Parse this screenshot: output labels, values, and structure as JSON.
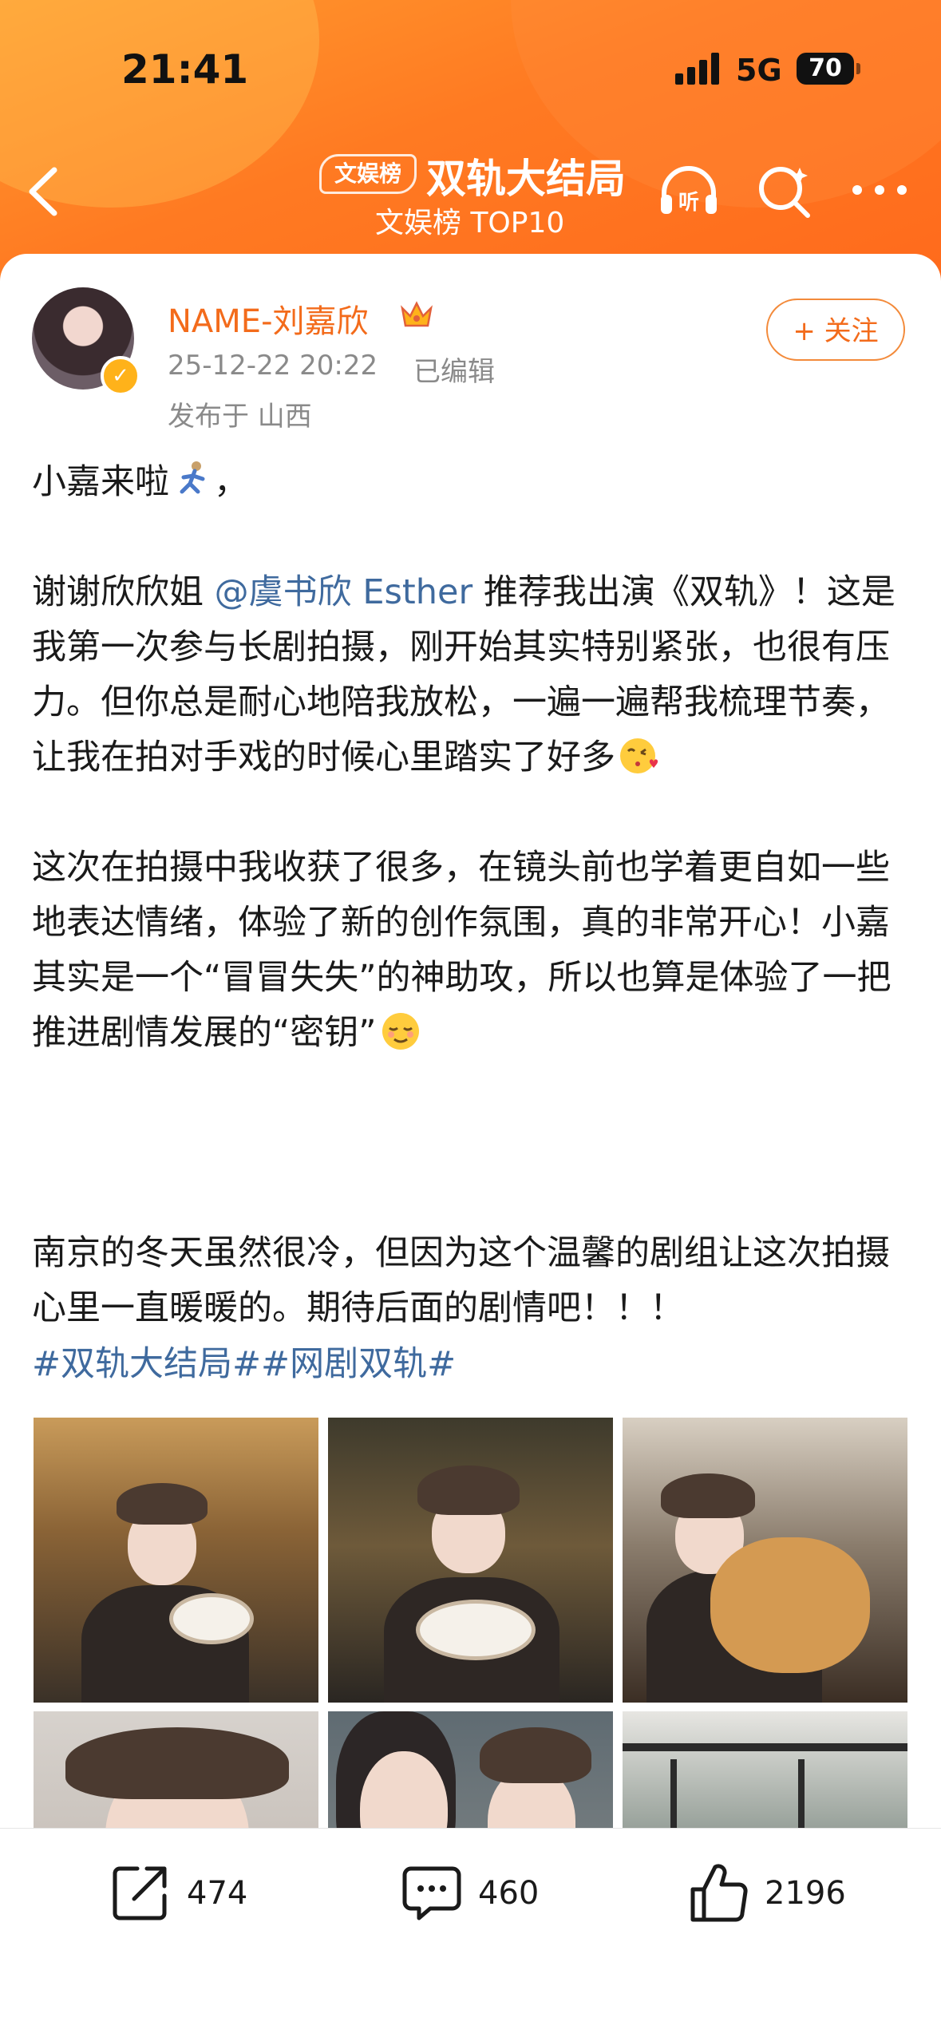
{
  "status_bar": {
    "time": "21:41",
    "network": "5G",
    "battery": "70"
  },
  "header": {
    "badge": "文娱榜",
    "title": "双轨大结局",
    "subtitle": "文娱榜 TOP10",
    "icons": [
      "back-icon",
      "listen-icon",
      "search-icon",
      "more-icon"
    ]
  },
  "post": {
    "user_name": "NAME-刘嘉欣",
    "time": "25-12-22 20:22",
    "edited": "已编辑",
    "location": "发布于 山西",
    "follow_label": "+ 关注",
    "paragraph1": "小嘉来啦",
    "p2_before": "谢谢欣欣姐 ",
    "p2_mention": "@虞书欣 Esther",
    "p2_after": " 推荐我出演《双轨》！这是我第一次参与长剧拍摄，刚开始其实特别紧张，也很有压力。但你总是耐心地陪我放松，一遍一遍帮我梳理节奏，让我在拍对手戏的时候心里踏实了好多",
    "paragraph3": "这次在拍摄中我收获了很多，在镜头前也学着更自如一些地表达情绪，体验了新的创作氛围，真的非常开心！小嘉其实是一个“冒冒失失”的神助攻，所以也算是体验了一把推进剧情发展的“密钥”",
    "paragraph4": "南京的冬天虽然很冷，但因为这个温馨的剧组让这次拍摄心里一直暖暖的。期待后面的剧情吧！！！",
    "hashtags": "#双轨大结局##网剧双轨#"
  },
  "actions": {
    "share_count": "474",
    "comment_count": "460",
    "like_count": "2196"
  },
  "colors": {
    "brand_orange": "#ff7a22",
    "link_blue": "#3f6a9e",
    "name_orange": "#f36b1b"
  }
}
